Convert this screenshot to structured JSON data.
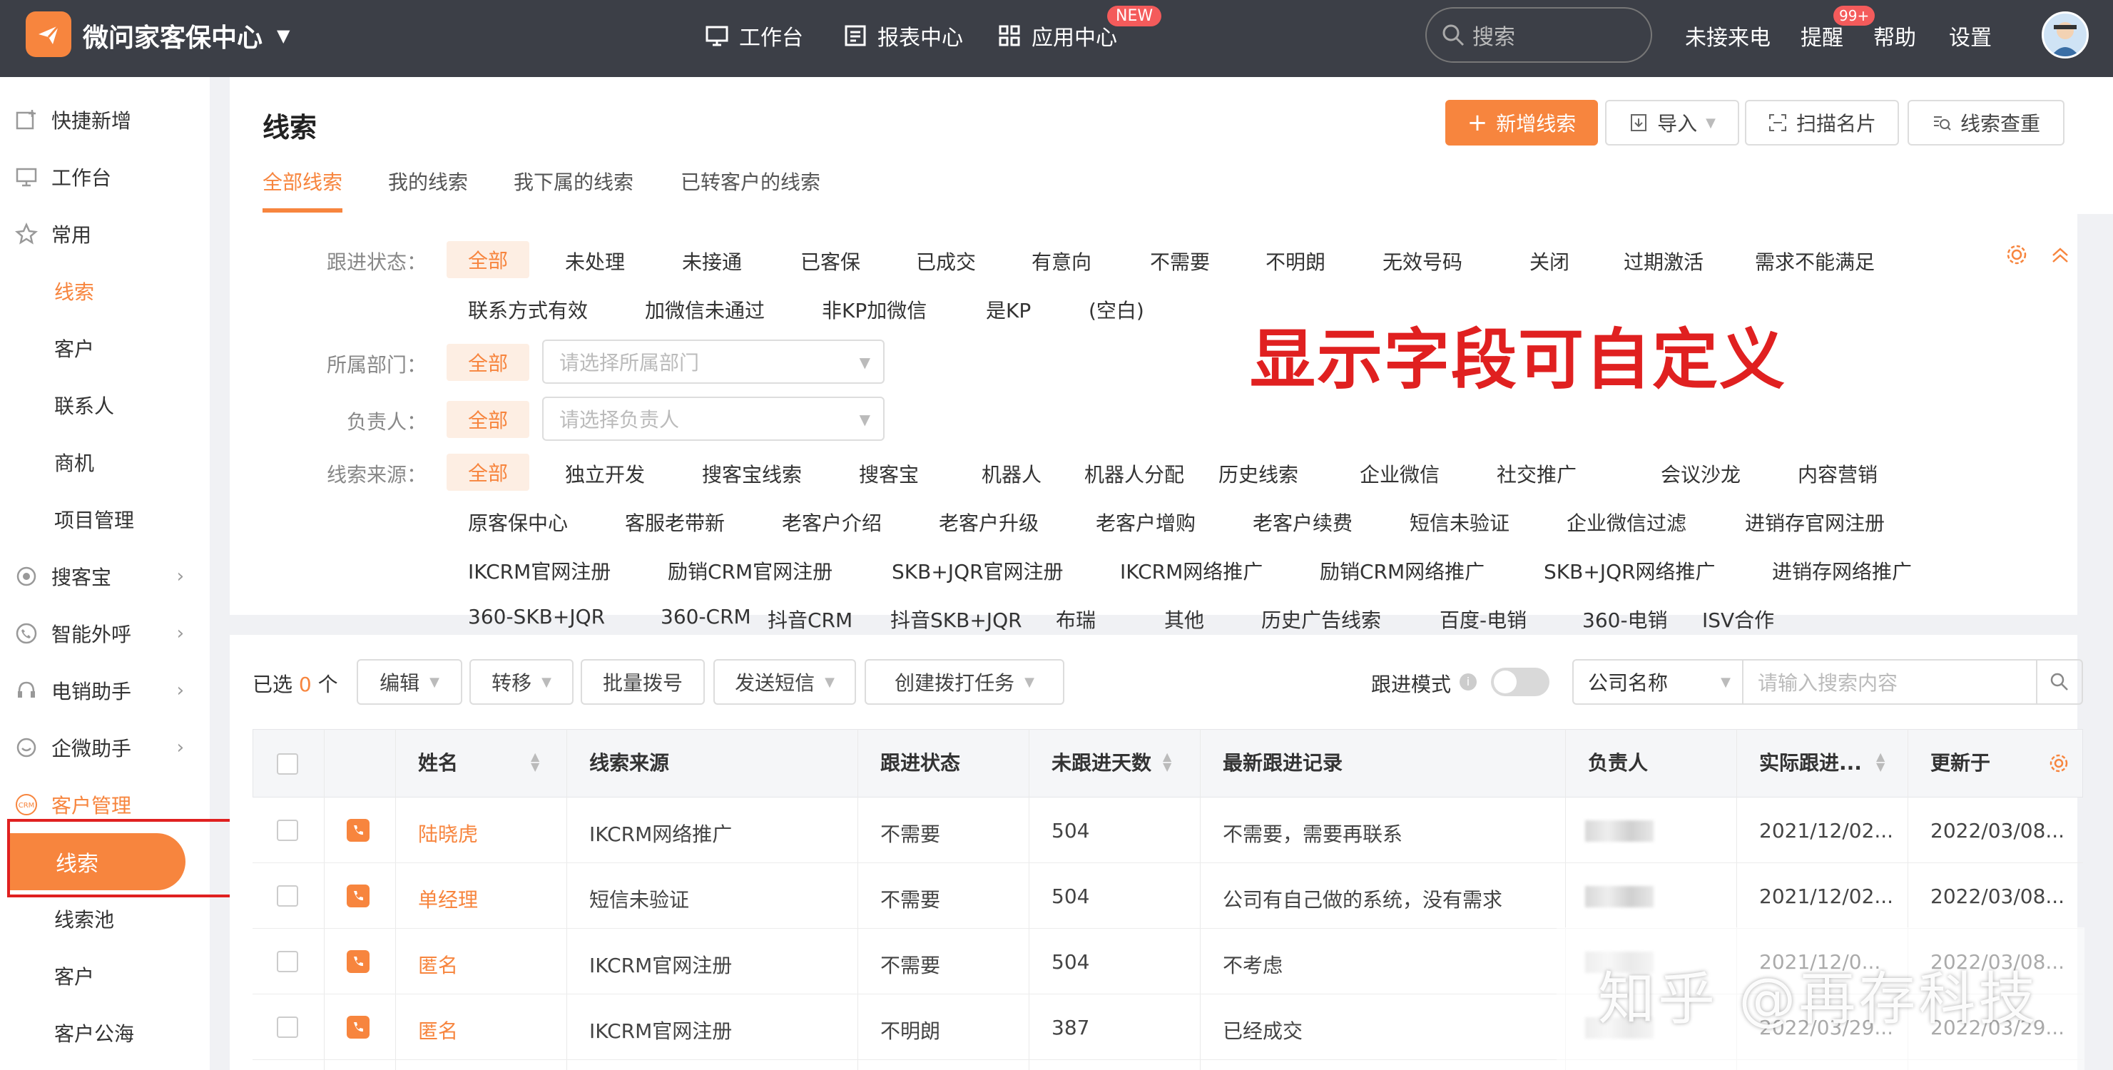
{
  "topbar": {
    "app_title": "微问家客保中心",
    "nav": [
      "工作台",
      "报表中心",
      "应用中心"
    ],
    "new_badge": "NEW",
    "search_placeholder": "搜索",
    "links": [
      "未接来电",
      "提醒",
      "帮助",
      "设置"
    ],
    "remind_badge": "99+"
  },
  "sidebar": {
    "quick_add": "快捷新增",
    "workbench": "工作台",
    "common": "常用",
    "common_items": [
      "线索",
      "客户",
      "联系人",
      "商机",
      "项目管理"
    ],
    "souke": "搜客宝",
    "outbound": "智能外呼",
    "telesales": "电销助手",
    "wechat": "企微助手",
    "crm_icon_text": "CRM",
    "customer_mgmt": "客户管理",
    "active_item": "线索",
    "mgmt_items": [
      "线索池",
      "客户",
      "客户公海"
    ]
  },
  "header": {
    "title": "线索",
    "add_button": "新增线索",
    "import_button": "导入",
    "scan_button": "扫描名片",
    "dedupe_button": "线索查重",
    "tabs": [
      "全部线索",
      "我的线索",
      "我下属的线索",
      "已转客户的线索"
    ]
  },
  "filters": {
    "status_label": "跟进状态：",
    "status_all": "全部",
    "status_row1": [
      "未处理",
      "未接通",
      "已客保",
      "已成交",
      "有意向",
      "不需要",
      "不明朗",
      "无效号码",
      "关闭",
      "过期激活",
      "需求不能满足"
    ],
    "status_row2": [
      "联系方式有效",
      "加微信未通过",
      "非KP加微信",
      "是KP",
      "(空白)"
    ],
    "dept_label": "所属部门：",
    "dept_all": "全部",
    "dept_placeholder": "请选择所属部门",
    "owner_label": "负责人：",
    "owner_all": "全部",
    "owner_placeholder": "请选择负责人",
    "source_label": "线索来源：",
    "source_all": "全部",
    "source_row1": [
      "独立开发",
      "搜客宝线索",
      "搜客宝",
      "机器人",
      "机器人分配",
      "历史线索",
      "企业微信",
      "社交推广",
      "会议沙龙",
      "内容营销"
    ],
    "source_row2": [
      "原客保中心",
      "客服老带新",
      "老客户介绍",
      "老客户升级",
      "老客户增购",
      "老客户续费",
      "短信未验证",
      "企业微信过滤",
      "进销存官网注册"
    ],
    "source_row3": [
      "IKCRM官网注册",
      "励销CRM官网注册",
      "SKB+JQR官网注册",
      "IKCRM网络推广",
      "励销CRM网络推广",
      "SKB+JQR网络推广",
      "进销存网络推广"
    ],
    "source_row4": [
      "360-SKB+JQR",
      "360-CRM",
      "抖音CRM",
      "抖音SKB+JQR",
      "布瑞",
      "其他",
      "历史广告线索",
      "百度-电销",
      "360-电销",
      "ISV合作"
    ],
    "custom_note": "显示字段可自定义"
  },
  "toolbar": {
    "selected_prefix": "已选",
    "selected_count": "0",
    "selected_suffix": "个",
    "edit": "编辑",
    "transfer": "转移",
    "batch_dial": "批量拨号",
    "send_sms": "发送短信",
    "create_task": "创建拨打任务",
    "follow_mode": "跟进模式",
    "search_field": "公司名称",
    "search_placeholder": "请输入搜索内容"
  },
  "table": {
    "columns": [
      "姓名",
      "线索来源",
      "跟进状态",
      "未跟进天数",
      "最新跟进记录",
      "负责人",
      "实际跟进...",
      "更新于"
    ],
    "rows": [
      {
        "name": "陆晓虎",
        "source": "IKCRM网络推广",
        "status": "不需要",
        "days": "504",
        "record": "不需要，需要再联系",
        "actual": "2021/12/02...",
        "updated": "2022/03/08..."
      },
      {
        "name": "单经理",
        "source": "短信未验证",
        "status": "不需要",
        "days": "504",
        "record": "公司有自己做的系统，没有需求",
        "actual": "2021/12/02...",
        "updated": "2022/03/08..."
      },
      {
        "name": "匿名",
        "source": "IKCRM官网注册",
        "status": "不需要",
        "days": "504",
        "record": "不考虑",
        "actual": "2021/12/0...",
        "updated": "2022/03/08..."
      },
      {
        "name": "匿名",
        "source": "IKCRM官网注册",
        "status": "不明朗",
        "days": "387",
        "record": "已经成交",
        "actual": "2022/03/29...",
        "updated": "2022/03/29..."
      }
    ]
  },
  "watermark": "知乎 @再存科技",
  "colors": {
    "accent": "#f7853e",
    "topbar": "#3c3f47",
    "annotation": "#e02020"
  }
}
